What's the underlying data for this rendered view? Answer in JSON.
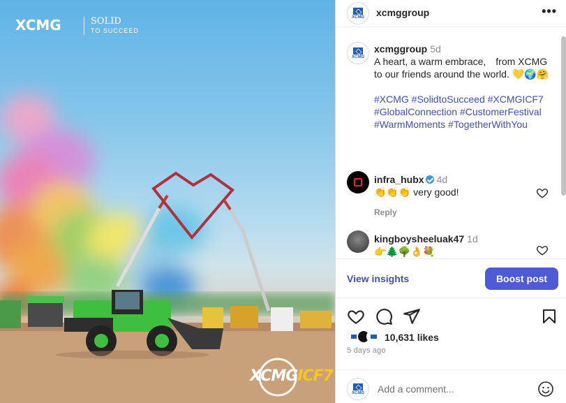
{
  "photo": {
    "brand": "XCMG",
    "slogan_line1": "SOLID",
    "slogan_line2": "TO SUCCEED",
    "event_logo_main": "XCMG",
    "event_logo_accent": "ICF7"
  },
  "header": {
    "username": "xcmggroup",
    "more_icon": "more-horizontal-icon"
  },
  "caption": {
    "username": "xcmggroup",
    "time": "5d",
    "text": "A heart, a warm embrace,　from XCMG to our friends around the world. 💛🌍🤗",
    "hashtags": "#XCMG #SolidtoSucceed #XCMGICF7 #GlobalConnection #CustomerFestival #WarmMoments #TogetherWithYou"
  },
  "comments": [
    {
      "username": "infra_hubx",
      "verified": true,
      "time": "4d",
      "text": "👏👏👏 very good!",
      "reply_label": "Reply"
    },
    {
      "username": "kingboysheeluak47",
      "verified": false,
      "time": "1d",
      "text": "👉🌲🌳👌💐"
    }
  ],
  "insights": {
    "view_label": "View insights",
    "boost_label": "Boost post"
  },
  "likes": {
    "count_text": "10,631 likes"
  },
  "posted_ago": "5 days ago",
  "add_comment": {
    "placeholder": "Add a comment..."
  },
  "colors": {
    "accent_link": "#3f51b5",
    "boost_button": "#4f5bd5",
    "brand_blue": "#1a5fb4",
    "loader_green": "#3fbf3f"
  }
}
